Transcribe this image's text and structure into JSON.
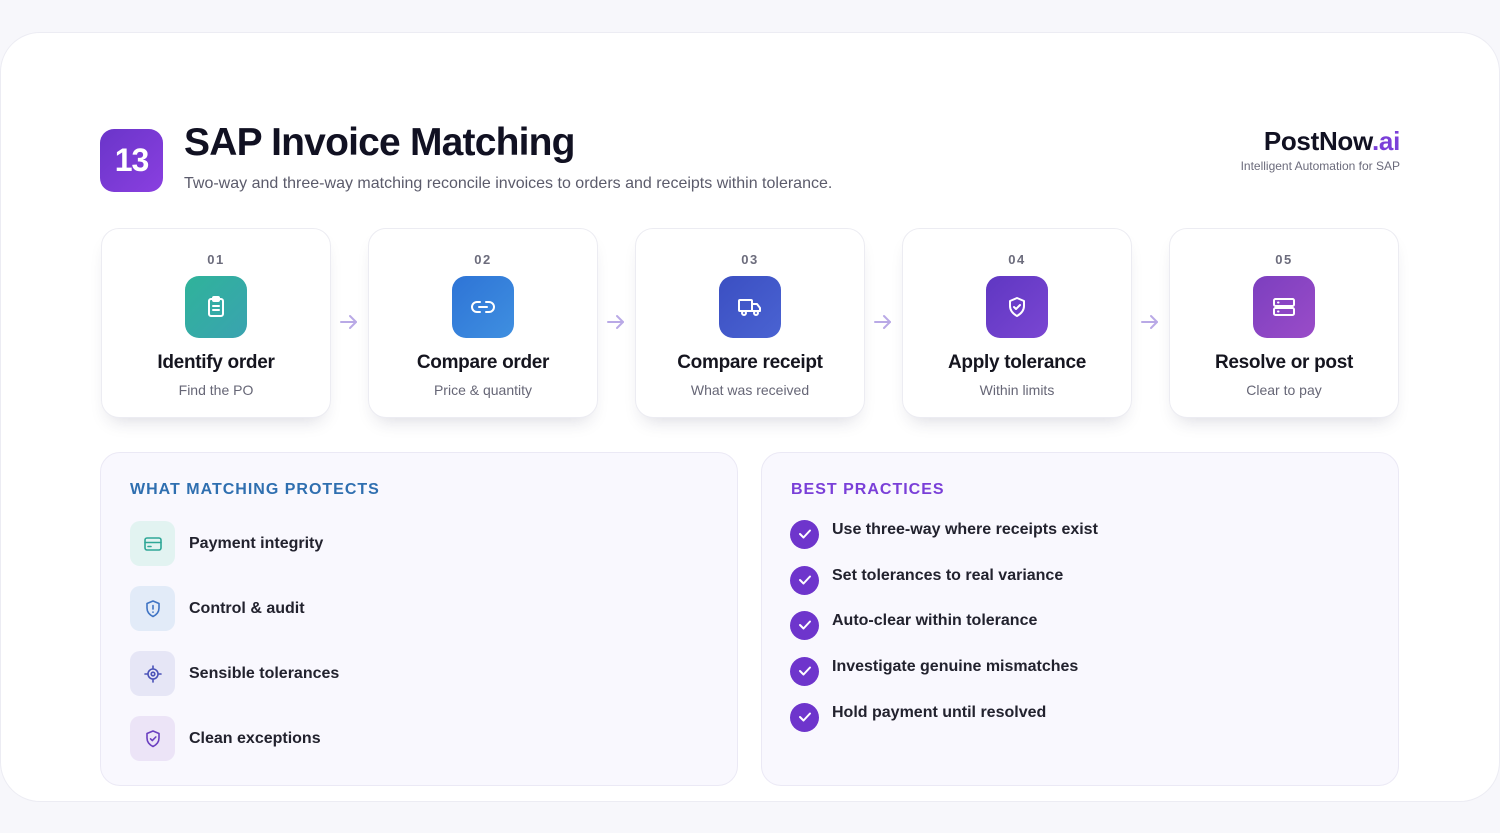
{
  "header": {
    "badge": "13",
    "title": "SAP Invoice Matching",
    "subtitle": "Two-way and three-way matching reconcile invoices to orders and receipts within tolerance."
  },
  "brand": {
    "name": "PostNow",
    "suffix": ".ai",
    "tagline": "Intelligent Automation for SAP"
  },
  "steps": [
    {
      "num": "01",
      "title": "Identify order",
      "sub": "Find the PO",
      "icon": "clipboard-icon",
      "color": "#2fae9c"
    },
    {
      "num": "02",
      "title": "Compare order",
      "sub": "Price & quantity",
      "icon": "link-icon",
      "color": "#2f7ed8"
    },
    {
      "num": "03",
      "title": "Compare receipt",
      "sub": "What was received",
      "icon": "truck-icon",
      "color": "#3f5ac9"
    },
    {
      "num": "04",
      "title": "Apply tolerance",
      "sub": "Within limits",
      "icon": "shield-check-icon",
      "color": "#6a3fc8"
    },
    {
      "num": "05",
      "title": "Resolve or post",
      "sub": "Clear to pay",
      "icon": "server-icon",
      "color": "#8a3fc0"
    }
  ],
  "protects": {
    "title": "WHAT MATCHING PROTECTS",
    "title_color": "#2f6fb0",
    "items": [
      {
        "label": "Payment integrity",
        "icon": "credit-card-icon"
      },
      {
        "label": "Control & audit",
        "icon": "shield-alert-icon"
      },
      {
        "label": "Sensible tolerances",
        "icon": "target-icon"
      },
      {
        "label": "Clean exceptions",
        "icon": "shield-check-icon"
      }
    ]
  },
  "best_practices": {
    "title": "BEST PRACTICES",
    "title_color": "#7a3fd8",
    "items": [
      "Use three-way where receipts exist",
      "Set tolerances to real variance",
      "Auto-clear within tolerance",
      "Investigate genuine mismatches",
      "Hold payment until resolved"
    ]
  }
}
